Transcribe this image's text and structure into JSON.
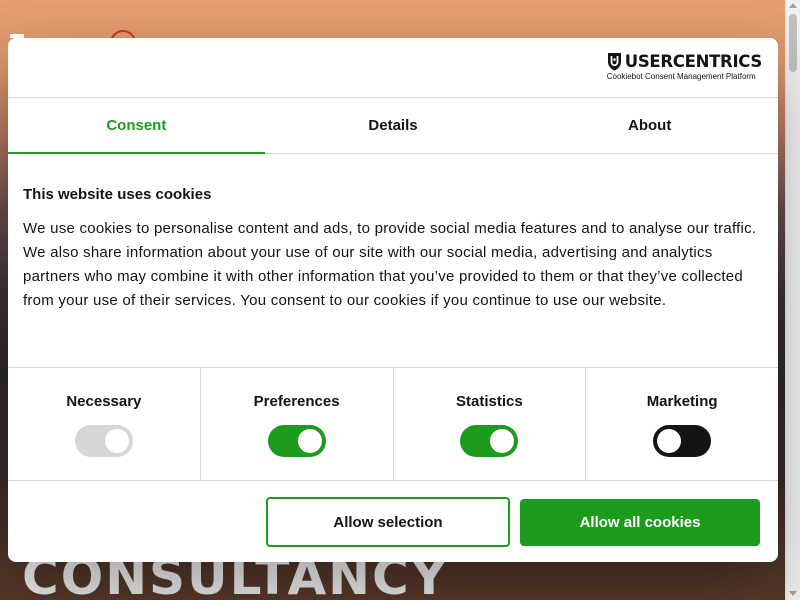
{
  "background": {
    "hero_word": "CONSULTANCY"
  },
  "brand": {
    "name": "USERCENTRICS",
    "subtitle": "Cookiebot Consent Management Platform",
    "icon": "usercentrics-shield-icon"
  },
  "tabs": [
    {
      "label": "Consent",
      "active": true
    },
    {
      "label": "Details",
      "active": false
    },
    {
      "label": "About",
      "active": false
    }
  ],
  "content": {
    "heading": "This website uses cookies",
    "body": "We use cookies to personalise content and ads, to provide social media features and to analyse our traffic. We also share information about your use of our site with our social media, advertising and analytics partners who may combine it with other information that you’ve provided to them or that they’ve collected from your use of their services. You consent to our cookies if you continue to use our website."
  },
  "toggles": [
    {
      "label": "Necessary",
      "state": "on-disabled"
    },
    {
      "label": "Preferences",
      "state": "on"
    },
    {
      "label": "Statistics",
      "state": "on"
    },
    {
      "label": "Marketing",
      "state": "off"
    }
  ],
  "buttons": {
    "allow_selection": "Allow selection",
    "allow_all": "Allow all cookies"
  },
  "colors": {
    "accent": "#1d9b1d",
    "text": "#141414",
    "divider": "#d6d6d6"
  }
}
